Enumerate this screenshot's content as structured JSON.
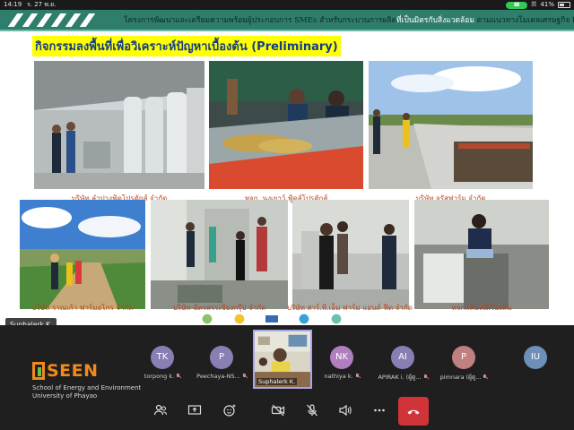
{
  "status_bar": {
    "time": "14:19",
    "date": "ร. 27 พ.ย.",
    "battery": "41%"
  },
  "slide": {
    "header_dark": "โครงการพัฒนาและเตรียมความพร้อมผู้ประกอบการ SMEs สำหรับกระบวนการผลิต",
    "header_light": "ที่เป็นมิตรกับสิ่งแวดล้อม",
    "header_tail": " ตามแนวทางโมเดลเศรษฐกิจ BCG",
    "title": "กิจกรรมลงพื้นที่เพื่อวิเคราะห์ปัญหาเบื้องต้น (Preliminary)",
    "captions": [
      "บริษัท ลำปางฟู้ดโปรดักส์ จำกัด",
      "หจก. นงเยาว์ ฟู้ดส์โปรดักส์",
      "บริษัท จรัสฟาร์ม จำกัด",
      "บริษัท ราณเก้า ฟาร์มอโกร จำกัด",
      "บริษัท ฉัตรสรรเซียงกรุ๊ป จำกัด",
      "บริษัท สาร์.พี.เอ็ม ฟาร์ม แอนด์ ฟีด จำกัด",
      "หจก.เส้นหมี่เรืองสิน"
    ]
  },
  "screen_share_badge": "Suphalerk K.",
  "logo": {
    "word": "SEEN",
    "line1": "School of Energy and Environment",
    "line2": "University of Phayao"
  },
  "participants": [
    {
      "initials": "TK",
      "name": "torpong k.",
      "color": "#8a7fb3"
    },
    {
      "initials": "P",
      "name": "Peechaya-NS...",
      "color": "#8a7fb3"
    },
    {
      "initials": "NK",
      "name": "nathiya k.",
      "color": "#b07fbf"
    },
    {
      "initials": "AI",
      "name": "APIRAK i. (ผู้ดู...",
      "color": "#8a7fb3"
    },
    {
      "initials": "P",
      "name": "pimnara (ผู้ดู...",
      "color": "#c08080"
    },
    {
      "initials": "IU",
      "name": "",
      "color": "#6d8fb8"
    }
  ],
  "active_speaker": "Suphalerk K.",
  "icons": {
    "people": "people-icon",
    "share": "share-screen-icon",
    "reactions": "reactions-icon",
    "camera": "camera-off-icon",
    "mic": "mic-off-icon",
    "speaker": "speaker-icon",
    "more": "more-icon",
    "hangup": "hang-up-icon"
  },
  "colors": {
    "header_green": "#2e7d6d",
    "title_highlight": "#ffff00",
    "title_text": "#123d8a",
    "caption": "#b8471f",
    "hangup": "#d13438",
    "active_border": "#a9a6e6"
  }
}
